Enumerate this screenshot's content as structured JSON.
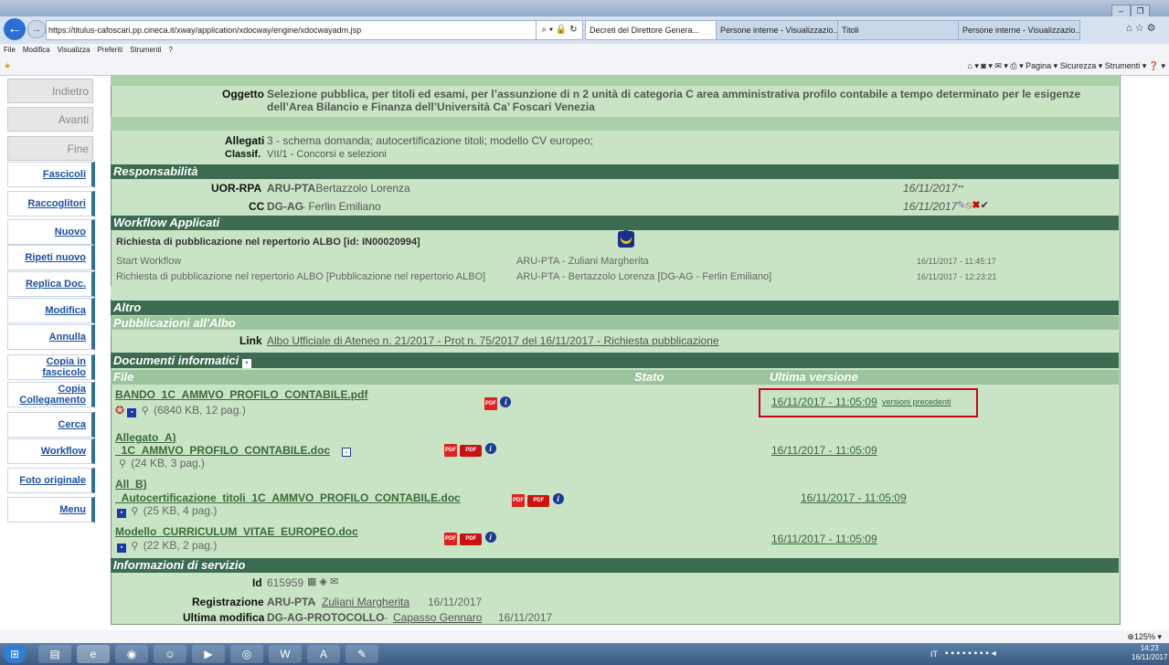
{
  "browser": {
    "url": "https://titulus-cafoscari.pp.cineca.it/xway/application/xdocway/engine/xdocwayadm.jsp",
    "tabs": [
      "Decreti del Direttore Genera...",
      "Persone interne - Visualizzazio...",
      "Titoli",
      "Persone interne - Visualizzazio..."
    ],
    "menu": [
      "File",
      "Modifica",
      "Visualizza",
      "Preferiti",
      "Strumenti",
      "?"
    ],
    "commands": "Pagina ▾   Sicurezza ▾   Strumenti ▾",
    "zoom": "125%",
    "clock_time": "14:23",
    "clock_date": "16/11/2017",
    "lang": "IT"
  },
  "nav": {
    "grey": [
      "Indietro",
      "Avanti",
      "Fine"
    ],
    "links": [
      "Fascicoli",
      "Raccoglitori",
      "Nuovo",
      "Ripeti nuovo",
      "Replica Doc.",
      "Modifica",
      "Annulla",
      "Copia in fascicolo",
      "Copia Collegamento",
      "Cerca",
      "Workflow",
      "Foto originale",
      "Menu"
    ]
  },
  "doc": {
    "oggetto_label": "Oggetto",
    "oggetto_line1": "Selezione pubblica, per titoli ed esami, per l’assunzione di n 2 unità di categoria C area amministrativa profilo contabile a tempo determinato per le esigenze",
    "oggetto_line2": "dell’Area Bilancio e Finanza dell’Università Ca’ Foscari Venezia",
    "allegati_label": "Allegati",
    "allegati_value": "3 -  schema domanda; autocertificazione titoli; modello CV europeo;",
    "classif_label": "Classif.",
    "classif_value": "VII/1 - Concorsi e selezioni",
    "resp_header": "Responsabilità",
    "uor_label": "UOR-RPA",
    "uor_value": "ARU-PTA",
    "uor_name": " - Bertazzolo Lorenza",
    "uor_date": "16/11/2017",
    "cc_label": "CC",
    "cc_value": "DG-AG",
    "cc_name": " - Ferlin Emiliano",
    "cc_date": "16/11/2017",
    "wf_header": "Workflow Applicati",
    "wf_title": "Richiesta di pubblicazione nel repertorio ALBO [id: IN00020994]",
    "wf_rows": [
      {
        "step": "Start Workflow",
        "who": "ARU-PTA - Zuliani Margherita",
        "when": "16/11/2017  -  11:45:17"
      },
      {
        "step": "Richiesta di pubblicazione nel repertorio ALBO [Pubblicazione nel repertorio ALBO]",
        "who": "ARU-PTA - Bertazzolo Lorenza [DG-AG - Ferlin Emiliano]",
        "when": "16/11/2017  -  12:23:21"
      }
    ],
    "altro_header": "Altro",
    "pub_header": "Pubblicazioni all'Albo",
    "link_label": "Link",
    "link_value": "Albo Ufficiale di Ateneo n. 21/2017 - Prot n. 75/2017 del 16/11/2017 - Richiesta pubblicazione",
    "docinf_header": "Documenti informatici",
    "col_file": "File",
    "col_stato": "Stato",
    "col_ultima": "Ultima versione",
    "files": [
      {
        "pre": "",
        "name": "BANDO_1C_AMMVO_PROFILO_CONTABILE.pdf",
        "meta": "(6840 KB, 12 pag.)",
        "date": "16/11/2017 - 11:05:09",
        "extra": "versioni precedenti"
      },
      {
        "pre": "Allegato_A)",
        "name": "_1C_AMMVO_PROFILO_CONTABILE.doc",
        "meta": "(24 KB, 3 pag.)",
        "date": "16/11/2017 - 11:05:09",
        "extra": ""
      },
      {
        "pre": "All_B)",
        "name": "_Autocertificazione_titoli_1C_AMMVO_PROFILO_CONTABILE.doc",
        "meta": "(25 KB, 4 pag.)",
        "date": "16/11/2017 - 11:05:09",
        "extra": ""
      },
      {
        "pre": "",
        "name": "Modello_CURRICULUM_VITAE_EUROPEO.doc",
        "meta": "(22 KB, 2 pag.)",
        "date": "16/11/2017 - 11:05:09",
        "extra": ""
      }
    ],
    "info_header": "Informazioni di servizio",
    "id_label": "Id",
    "id_value": "615959",
    "reg_label": "Registrazione",
    "reg_uor": "ARU-PTA",
    "reg_name": "Zuliani Margherita",
    "reg_date": "16/11/2017",
    "mod_label": "Ultima modifica",
    "mod_uor": "DG-AG-PROTOCOLLO",
    "mod_name": "Capasso Gennaro",
    "mod_date": "16/11/2017"
  },
  "colors": {
    "header_green": "#3d6b52",
    "panel_green": "#c9e4c4",
    "highlight_red": "#d0021b"
  }
}
